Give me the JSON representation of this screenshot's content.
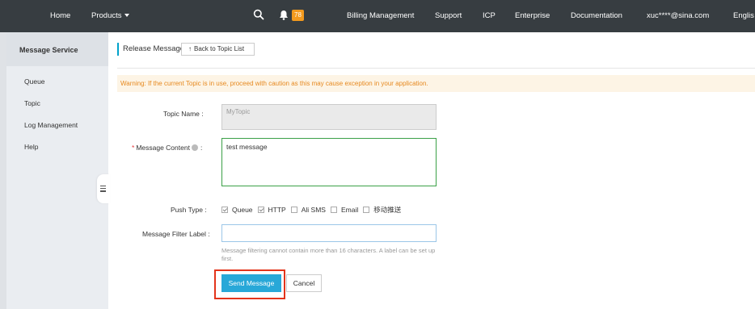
{
  "nav": {
    "home": "Home",
    "products": "Products",
    "badge_count": "78",
    "billing": "Billing Management",
    "support": "Support",
    "icp": "ICP",
    "enterprise": "Enterprise",
    "documentation": "Documentation",
    "user": "xuc****@sina.com",
    "language": "Englis"
  },
  "sidebar": {
    "title": "Message Service",
    "items": [
      {
        "label": "Queue"
      },
      {
        "label": "Topic"
      },
      {
        "label": "Log Management"
      },
      {
        "label": "Help"
      }
    ]
  },
  "main": {
    "page_title": "Release Message",
    "back_label": "Back to Topic List",
    "warning": "Warning: If the current Topic is in use, proceed with caution as this may cause exception in your application.",
    "topic_name_label": "Topic Name :",
    "topic_name_value": "MyTopic",
    "message_content_label": "Message Content",
    "message_content_colon": ":",
    "message_content_value": "test message",
    "push_type_label": "Push Type :",
    "push_options": [
      {
        "label": "Queue",
        "checked": true
      },
      {
        "label": "HTTP",
        "checked": true
      },
      {
        "label": "Ali SMS",
        "checked": false
      },
      {
        "label": "Email",
        "checked": false
      },
      {
        "label": "移动推送",
        "checked": false
      }
    ],
    "filter_label": "Message Filter Label :",
    "filter_value": "",
    "filter_hint": "Message filtering cannot contain more than 16 characters. A label can be set up first.",
    "send_label": "Send Message",
    "cancel_label": "Cancel"
  },
  "colors": {
    "topbar": "#373d41",
    "accent": "#28a8d8",
    "warning_text": "#e6881e",
    "highlight": "#e3341b",
    "badge": "#f39a1e"
  }
}
